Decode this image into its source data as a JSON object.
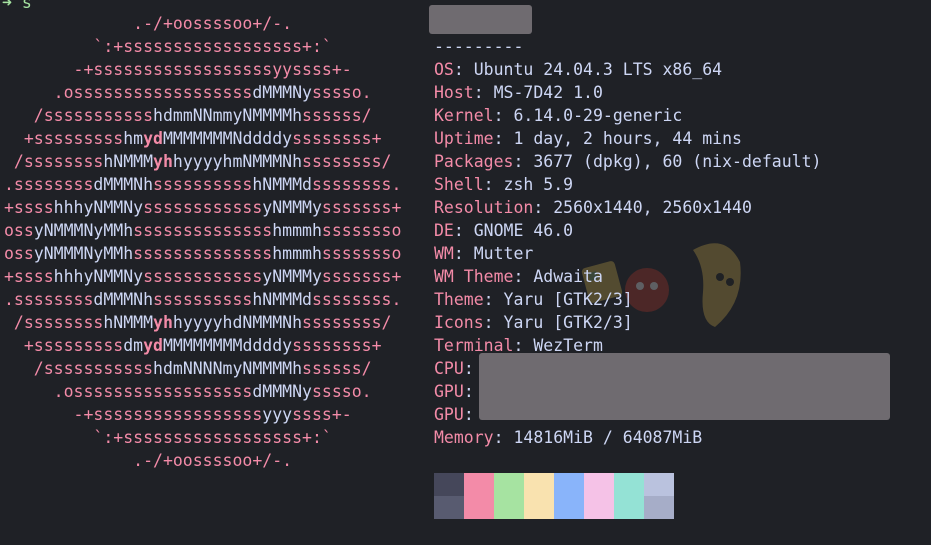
{
  "prompt": {
    "arrow": "➜",
    "command": "s"
  },
  "logo_lines": [
    [
      [
        "p",
        "             .-/+oossssoo+/-."
      ]
    ],
    [
      [
        "p",
        "         `:+ssssssssssssssssss+:`"
      ]
    ],
    [
      [
        "p",
        "       -+ssssssssssssssssssyyssss+-"
      ]
    ],
    [
      [
        "p",
        "     .ossssssssssssssssss"
      ],
      [
        "w",
        "dMMMNy"
      ],
      [
        "p",
        "sssso."
      ]
    ],
    [
      [
        "p",
        "   /sssssssssss"
      ],
      [
        "w",
        "hdmmNNmmyNMMMMh"
      ],
      [
        "p",
        "ssssss/"
      ]
    ],
    [
      [
        "p",
        "  +sssssssss"
      ],
      [
        "w",
        "hm"
      ],
      [
        "r",
        "yd"
      ],
      [
        "w",
        "MMMMMMMNddddy"
      ],
      [
        "p",
        "ssssssss+"
      ]
    ],
    [
      [
        "p",
        " /ssssssss"
      ],
      [
        "w",
        "hNMMM"
      ],
      [
        "r",
        "yh"
      ],
      [
        "w",
        "hyyyyhmNMMMNh"
      ],
      [
        "p",
        "ssssssss/"
      ]
    ],
    [
      [
        "p",
        ".ssssssss"
      ],
      [
        "w",
        "dMMMNh"
      ],
      [
        "p",
        "ssssssssss"
      ],
      [
        "w",
        "hNMMMd"
      ],
      [
        "p",
        "ssssssss."
      ]
    ],
    [
      [
        "p",
        "+ssss"
      ],
      [
        "w",
        "hhhyNMMNy"
      ],
      [
        "p",
        "ssssssssssss"
      ],
      [
        "w",
        "yNMMMy"
      ],
      [
        "p",
        "sssssss+"
      ]
    ],
    [
      [
        "p",
        "oss"
      ],
      [
        "w",
        "yNMMMNyMMh"
      ],
      [
        "p",
        "ssssssssssssss"
      ],
      [
        "w",
        "hmmmh"
      ],
      [
        "p",
        "ssssssso"
      ]
    ],
    [
      [
        "p",
        "oss"
      ],
      [
        "w",
        "yNMMMNyMMh"
      ],
      [
        "p",
        "ssssssssssssss"
      ],
      [
        "w",
        "hmmmh"
      ],
      [
        "p",
        "ssssssso"
      ]
    ],
    [
      [
        "p",
        "+ssss"
      ],
      [
        "w",
        "hhhyNMMNy"
      ],
      [
        "p",
        "ssssssssssss"
      ],
      [
        "w",
        "yNMMMy"
      ],
      [
        "p",
        "sssssss+"
      ]
    ],
    [
      [
        "p",
        ".ssssssss"
      ],
      [
        "w",
        "dMMMNh"
      ],
      [
        "p",
        "ssssssssss"
      ],
      [
        "w",
        "hNMMMd"
      ],
      [
        "p",
        "ssssssss."
      ]
    ],
    [
      [
        "p",
        " /ssssssss"
      ],
      [
        "w",
        "hNMMM"
      ],
      [
        "r",
        "yh"
      ],
      [
        "w",
        "hyyyyhdNMMMNh"
      ],
      [
        "p",
        "ssssssss/"
      ]
    ],
    [
      [
        "p",
        "  +sssssssss"
      ],
      [
        "w",
        "dm"
      ],
      [
        "r",
        "yd"
      ],
      [
        "w",
        "MMMMMMMMddddy"
      ],
      [
        "p",
        "ssssssss+"
      ]
    ],
    [
      [
        "p",
        "   /sssssssssss"
      ],
      [
        "w",
        "hdmNNNNmyNMMMMh"
      ],
      [
        "p",
        "ssssss/"
      ]
    ],
    [
      [
        "p",
        "     .ossssssssssssssssss"
      ],
      [
        "w",
        "dMMMNy"
      ],
      [
        "p",
        "sssso."
      ]
    ],
    [
      [
        "p",
        "       -+sssssssssssssssss"
      ],
      [
        "w",
        "yyy"
      ],
      [
        "p",
        "ssss+-"
      ]
    ],
    [
      [
        "p",
        "         `:+ssssssssssssssssss+:`"
      ]
    ],
    [
      [
        "p",
        "             .-/+oossssoo+/-."
      ]
    ]
  ],
  "separator": "---------",
  "info": [
    {
      "key": "OS",
      "value": "Ubuntu 24.04.3 LTS x86_64"
    },
    {
      "key": "Host",
      "value": "MS-7D42 1.0"
    },
    {
      "key": "Kernel",
      "value": "6.14.0-29-generic"
    },
    {
      "key": "Uptime",
      "value": "1 day, 2 hours, 44 mins"
    },
    {
      "key": "Packages",
      "value": "3677 (dpkg), 60 (nix-default)"
    },
    {
      "key": "Shell",
      "value": "zsh 5.9"
    },
    {
      "key": "Resolution",
      "value": "2560x1440, 2560x1440"
    },
    {
      "key": "DE",
      "value": "GNOME 46.0"
    },
    {
      "key": "WM",
      "value": "Mutter"
    },
    {
      "key": "WM Theme",
      "value": "Adwaita"
    },
    {
      "key": "Theme",
      "value": "Yaru [GTK2/3]"
    },
    {
      "key": "Icons",
      "value": "Yaru [GTK2/3]"
    },
    {
      "key": "Terminal",
      "value": "WezTerm"
    },
    {
      "key": "CPU",
      "value": ""
    },
    {
      "key": "GPU",
      "value": ""
    },
    {
      "key": "GPU",
      "value": ""
    },
    {
      "key": "Memory",
      "value": "14816MiB / 64087MiB"
    }
  ],
  "palette": {
    "row1": [
      "#45475a",
      "#f38ba8",
      "#a6e3a1",
      "#f9e2af",
      "#89b4fa",
      "#f5c2e7",
      "#94e2d5",
      "#bac2de"
    ],
    "row2": [
      "#585b70",
      "#f38ba8",
      "#a6e3a1",
      "#f9e2af",
      "#89b4fa",
      "#f5c2e7",
      "#94e2d5",
      "#a6adc8"
    ]
  },
  "colors": {
    "background": "#1f2126",
    "accent": "#f38ba8",
    "text": "#cdd6f4",
    "redaction": "#6f6b70"
  },
  "icons": {
    "prompt": "arrow-icon",
    "wallpaper": "fruit-mascot-image"
  }
}
